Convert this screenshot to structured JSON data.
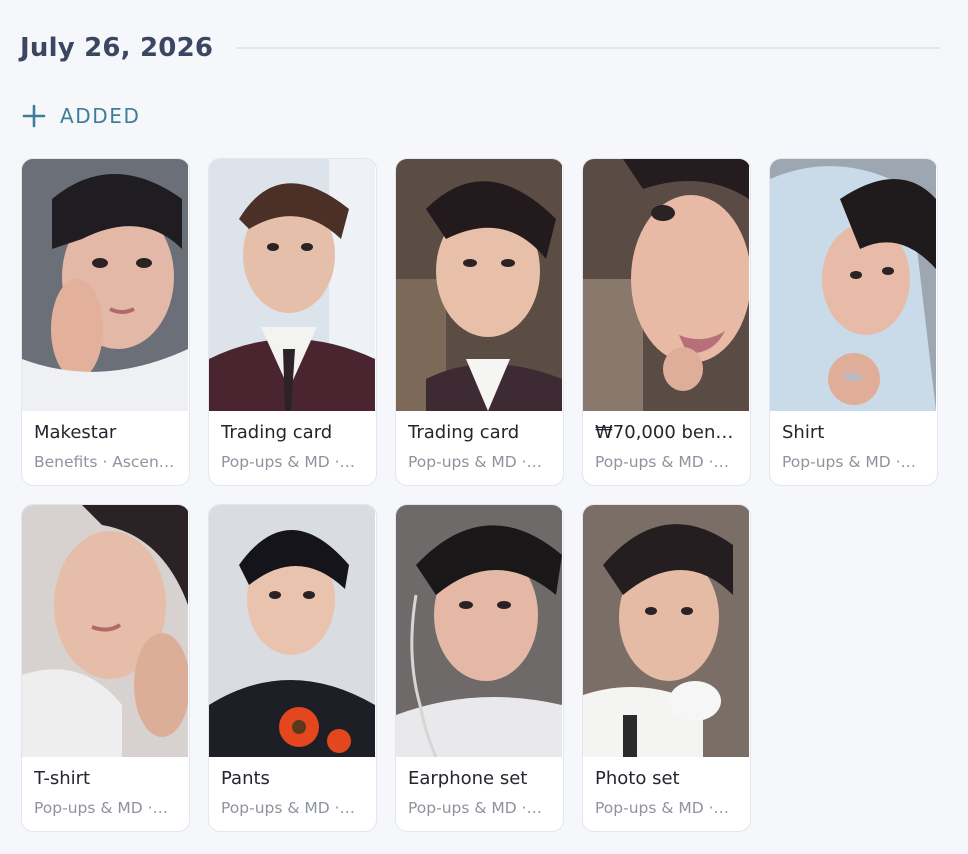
{
  "header": {
    "date": "July 26, 2026"
  },
  "section": {
    "label": "ADDED",
    "icon": "plus-icon",
    "accent": "#3d7f99"
  },
  "items": [
    {
      "name": "Makestar",
      "meta": "Benefits · Ascen…"
    },
    {
      "name": "Trading card",
      "meta": "Pop-ups & MD ·…"
    },
    {
      "name": "Trading card",
      "meta": "Pop-ups & MD ·…"
    },
    {
      "name": "₩70,000 bene…",
      "meta": "Pop-ups & MD ·…"
    },
    {
      "name": "Shirt",
      "meta": "Pop-ups & MD ·…"
    },
    {
      "name": "T-shirt",
      "meta": "Pop-ups & MD ·…"
    },
    {
      "name": "Pants",
      "meta": "Pop-ups & MD ·…"
    },
    {
      "name": "Earphone set",
      "meta": "Pop-ups & MD ·…"
    },
    {
      "name": "Photo set",
      "meta": "Pop-ups & MD ·…"
    }
  ]
}
